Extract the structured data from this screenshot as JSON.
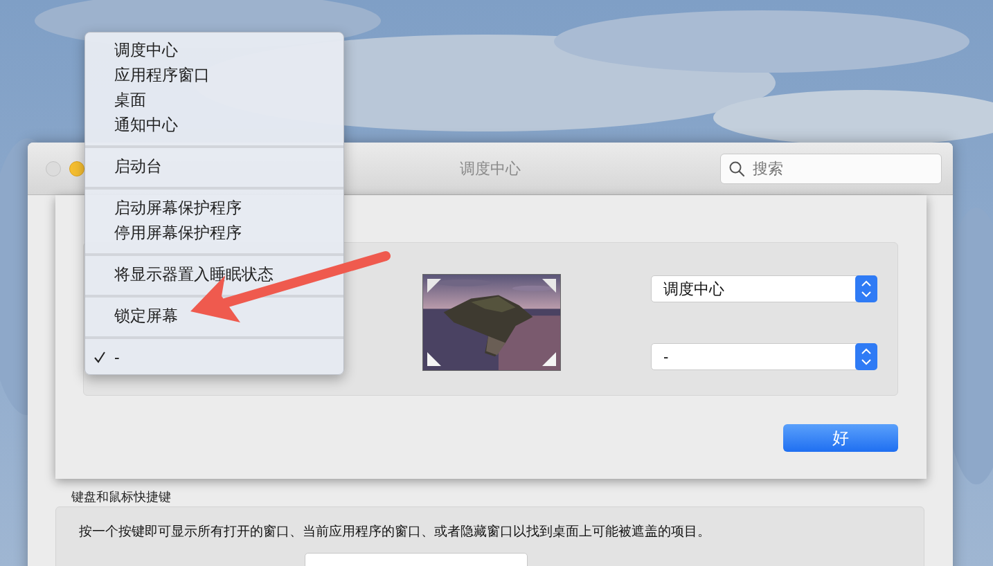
{
  "window": {
    "title": "调度中心",
    "search": {
      "placeholder": "搜索"
    }
  },
  "sheet": {
    "corners": [
      {
        "value": "调度中心"
      },
      {
        "value": "-"
      }
    ],
    "ok_button": "好"
  },
  "menu": {
    "groups": [
      {
        "items": [
          {
            "label": "调度中心",
            "checked": false
          },
          {
            "label": "应用程序窗口",
            "checked": false
          },
          {
            "label": "桌面",
            "checked": false
          },
          {
            "label": "通知中心",
            "checked": false
          }
        ]
      },
      {
        "items": [
          {
            "label": "启动台",
            "checked": false
          }
        ]
      },
      {
        "items": [
          {
            "label": "启动屏幕保护程序",
            "checked": false
          },
          {
            "label": "停用屏幕保护程序",
            "checked": false
          }
        ]
      },
      {
        "items": [
          {
            "label": "将显示器置入睡眠状态",
            "checked": false
          }
        ]
      },
      {
        "items": [
          {
            "label": "锁定屏幕",
            "checked": false
          }
        ]
      },
      {
        "items": [
          {
            "label": "-",
            "checked": true
          }
        ]
      }
    ]
  },
  "shortcuts": {
    "heading": "键盘和鼠标快捷键",
    "description": "按一个按键即可显示所有打开的窗口、当前应用程序的窗口、或者隐藏窗口以找到桌面上可能被遮盖的项目。"
  }
}
